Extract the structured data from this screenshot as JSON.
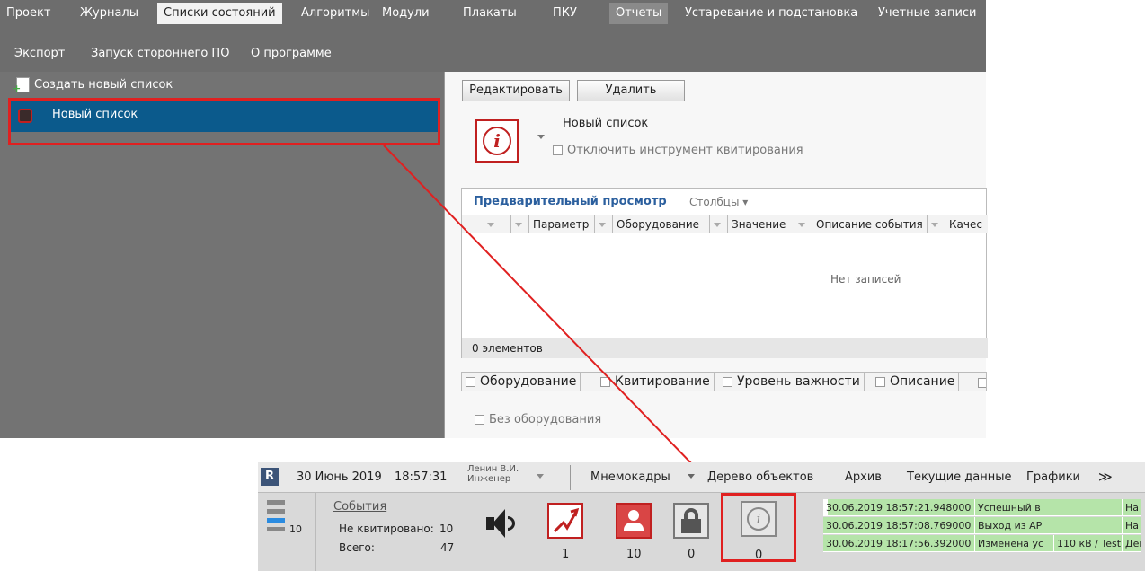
{
  "menu": {
    "row1": [
      "Проект",
      "Журналы",
      "Списки состояний",
      "Алгоритмы",
      "Модули",
      "Плакаты",
      "ПКУ",
      "Отчеты",
      "Устаревание и подстановка",
      "Учетные записи"
    ],
    "row2": [
      "Экспорт",
      "Запуск стороннего ПО",
      "О программе"
    ]
  },
  "left": {
    "create_label": "Создать новый список",
    "item_label": "Новый список"
  },
  "right": {
    "edit_btn": "Редактировать",
    "delete_btn": "Удалить",
    "list_name": "Новый список",
    "disable_ack": "Отключить инструмент квитирования",
    "preview_tab": "Предварительный просмотр",
    "columns_tab": "Столбцы ▾",
    "headers": [
      "Параметр",
      "Оборудование",
      "Значение",
      "Описание события",
      "Качес"
    ],
    "empty_text": "Нет записей",
    "count_text": "0 элементов",
    "filters": [
      "Оборудование",
      "Квитирование",
      "Уровень важности",
      "Описание"
    ],
    "no_equipment": "Без оборудования"
  },
  "bottom": {
    "logo": "R",
    "date": "30 Июнь 2019",
    "time": "18:57:31",
    "user_name": "Ленин В.И.",
    "user_role": "Инженер",
    "nav": [
      "Мнемокадры",
      "Дерево объектов",
      "Архив",
      "Текущие данные",
      "Графики",
      "≫"
    ],
    "level_count": "10",
    "events_link": "События",
    "unacked_label": "Не квитировано:",
    "unacked_value": "10",
    "total_label": "Всего:",
    "total_value": "47",
    "tile_counts": [
      "1",
      "10",
      "0",
      "0"
    ],
    "events": [
      {
        "time": "30.06.2019 18:57:21.948000",
        "text": "Успешный в",
        "obj": "",
        "tail": "На"
      },
      {
        "time": "30.06.2019 18:57:08.769000",
        "text": "Выход из АР",
        "obj": "",
        "tail": "На"
      },
      {
        "time": "30.06.2019 18:17:56.392000",
        "text": "Изменена ус",
        "obj": "110 кВ / Test",
        "tail": "Дей"
      }
    ]
  },
  "colors": {
    "highlight": "#e02020",
    "selected": "#0b5a8c",
    "event_bg": "#b5e4a9"
  }
}
